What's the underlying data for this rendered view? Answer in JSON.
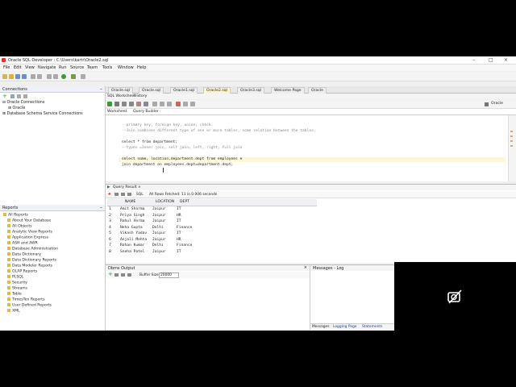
{
  "window": {
    "title": "Oracle SQL Developer : C:\\Users\\kartr\\Oracle2.sql"
  },
  "menu": [
    "File",
    "Edit",
    "View",
    "Navigate",
    "Run",
    "Source",
    "Team",
    "Tools",
    "Window",
    "Help"
  ],
  "connections": {
    "title": "Connections",
    "items": [
      "Oracle Connections",
      "Oracle",
      "Database Schema Service Connections"
    ]
  },
  "tabs": [
    {
      "label": "Oracle.sql"
    },
    {
      "label": "Oracle.sql"
    },
    {
      "label": "Oracle1.sql"
    },
    {
      "label": "Oracle2.sql"
    },
    {
      "label": "Oracle3.sql"
    },
    {
      "label": "Welcome Page"
    },
    {
      "label": "Oracle"
    }
  ],
  "worksheet": {
    "tab1": "SQL Worksheet",
    "tab2": "History",
    "sub1": "Worksheet",
    "sub2": "Query Builder",
    "connection": "Oracle"
  },
  "editor_lines": [
    "--primary key, foreign key, union, check.",
    "--Join combines different type of one or more tables, some relation between the tables.",
    "",
    "select * from department;",
    "--types =Inner join, self join, left, right, full join",
    "",
    "select name, location,department.dept from employees e",
    "join department on employees.dept=department.dept;"
  ],
  "result": {
    "tab": "Query Result",
    "sql_label": "SQL",
    "status": "All Rows Fetched: 11 in 0.006 seconds",
    "columns": [
      "NAME",
      "LOCATION",
      "DEPT"
    ],
    "rows": [
      [
        "1",
        "Amit Sharma",
        "Jaipur",
        "IT"
      ],
      [
        "2",
        "Priya Singh",
        "Jaipur",
        "HR"
      ],
      [
        "3",
        "Rahul Verma",
        "Jaipur",
        "IT"
      ],
      [
        "4",
        "Neha Gupta",
        "Delhi",
        "Finance"
      ],
      [
        "5",
        "Vikash Yadav",
        "Jaipur",
        "IT"
      ],
      [
        "6",
        "Anjali Mehta",
        "Jaipur",
        "HR"
      ],
      [
        "7",
        "Rohan Kumar",
        "Delhi",
        "Finance"
      ],
      [
        "8",
        "Sneha Patel",
        "Jaipur",
        "IT"
      ]
    ]
  },
  "reports": {
    "title": "Reports",
    "items": [
      "All Reports",
      "About Your Database",
      "All Objects",
      "Analytic View Reports",
      "Application Express",
      "ASH and AWR",
      "Database Administration",
      "Data Dictionary",
      "Data Dictionary Reports",
      "Data Modeler Reports",
      "OLAP Reports",
      "PLSQL",
      "Security",
      "Streams",
      "Table",
      "TimesTen Reports",
      "User Defined Reports",
      "XML"
    ]
  },
  "dbms": {
    "title": "Dbms Output",
    "buffer_label": "Buffer Size:",
    "buffer_value": "20000"
  },
  "messages": {
    "title": "Messages - Log",
    "tabs": [
      "Messages",
      "Logging Page",
      "Statements"
    ]
  }
}
